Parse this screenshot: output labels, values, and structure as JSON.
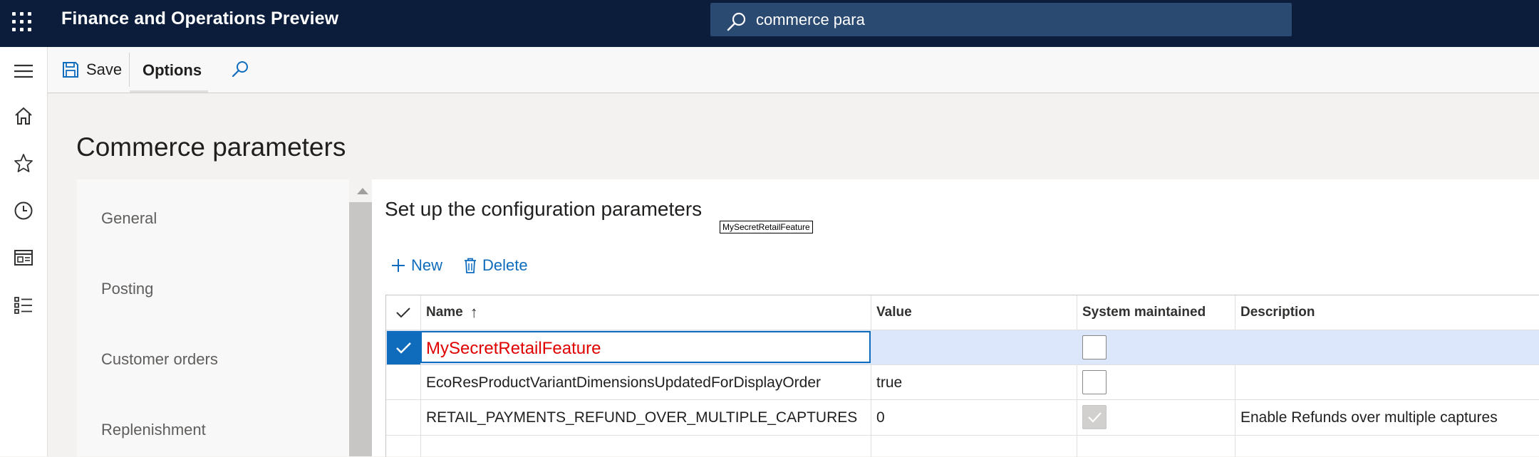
{
  "app": {
    "title": "Finance and Operations Preview",
    "search_value": "commerce para"
  },
  "actionbar": {
    "save_label": "Save",
    "options_label": "Options"
  },
  "nav_icons": [
    "home-icon",
    "star-icon",
    "clock-icon",
    "workspace-icon",
    "list-icon"
  ],
  "page": {
    "title": "Commerce parameters"
  },
  "tabs": [
    "General",
    "Posting",
    "Customer orders",
    "Replenishment"
  ],
  "section": {
    "title": "Set up the configuration parameters",
    "tooltip": "MySecretRetailFeature",
    "new_label": "New",
    "delete_label": "Delete"
  },
  "grid": {
    "columns": [
      "Name",
      "Value",
      "System maintained",
      "Description"
    ],
    "sort_indicator": "↑",
    "rows": [
      {
        "name": "MySecretRetailFeature",
        "value": "",
        "system_maintained": false,
        "system_disabled": false,
        "description": "",
        "selected": true
      },
      {
        "name": "EcoResProductVariantDimensionsUpdatedForDisplayOrder",
        "value": "true",
        "system_maintained": false,
        "system_disabled": false,
        "description": "",
        "selected": false
      },
      {
        "name": "RETAIL_PAYMENTS_REFUND_OVER_MULTIPLE_CAPTURES",
        "value": "0",
        "system_maintained": true,
        "system_disabled": true,
        "description": "Enable Refunds over multiple captures",
        "selected": false
      }
    ]
  },
  "colors": {
    "topbar": "#0b1d3a",
    "accent": "#0f6cbd",
    "selected_row": "#dde7fb",
    "edit_text": "#e00000"
  }
}
